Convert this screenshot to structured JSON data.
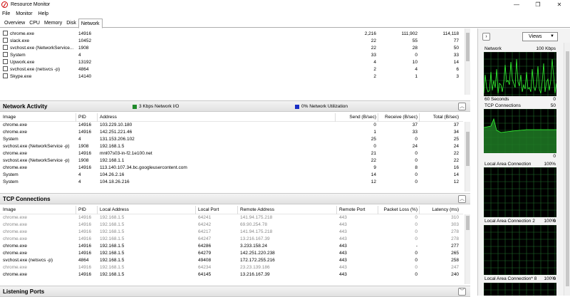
{
  "window": {
    "title": "Resource Monitor",
    "controls": {
      "minimize": "—",
      "restore": "❐",
      "close": "✕"
    }
  },
  "menu": [
    "File",
    "Monitor",
    "Help"
  ],
  "tabs": [
    {
      "label": "Overview",
      "active": false
    },
    {
      "label": "CPU",
      "active": false
    },
    {
      "label": "Memory",
      "active": false
    },
    {
      "label": "Disk",
      "active": false
    },
    {
      "label": "Network",
      "active": true
    }
  ],
  "processes": [
    {
      "name": "chrome.exe",
      "pid": "14916",
      "c1": "2,216",
      "c2": "111,902",
      "c3": "114,118"
    },
    {
      "name": "slack.exe",
      "pid": "10452",
      "c1": "22",
      "c2": "55",
      "c3": "77"
    },
    {
      "name": "svchost.exe (NetworkService...",
      "pid": "1908",
      "c1": "22",
      "c2": "28",
      "c3": "50"
    },
    {
      "name": "System",
      "pid": "4",
      "c1": "33",
      "c2": "0",
      "c3": "33"
    },
    {
      "name": "Upwork.exe",
      "pid": "13192",
      "c1": "4",
      "c2": "10",
      "c3": "14"
    },
    {
      "name": "svchost.exe (netsvcs -p)",
      "pid": "4864",
      "c1": "2",
      "c2": "4",
      "c3": "6"
    },
    {
      "name": "Skype.exe",
      "pid": "14140",
      "c1": "2",
      "c2": "1",
      "c3": "3"
    }
  ],
  "network_activity": {
    "title": "Network Activity",
    "legend_io": "3 Kbps Network I/O",
    "legend_util": "0% Network Utilization",
    "io_color": "#1f8a2a",
    "util_color": "#1a2fc4",
    "columns": [
      "Image",
      "PID",
      "Address",
      "Send (B/sec)",
      "Receive (B/sec)",
      "Total (B/sec)"
    ],
    "rows": [
      {
        "image": "chrome.exe",
        "pid": "14916",
        "address": "103.229.10.180",
        "send": "0",
        "recv": "37",
        "total": "37"
      },
      {
        "image": "chrome.exe",
        "pid": "14916",
        "address": "142.251.221.46",
        "send": "1",
        "recv": "33",
        "total": "34"
      },
      {
        "image": "System",
        "pid": "4",
        "address": "131.153.206.102",
        "send": "25",
        "recv": "0",
        "total": "25"
      },
      {
        "image": "svchost.exe (NetworkService -p)",
        "pid": "1908",
        "address": "192.168.1.5",
        "send": "0",
        "recv": "24",
        "total": "24"
      },
      {
        "image": "chrome.exe",
        "pid": "14916",
        "address": "mnl07s03-in-f2.1e100.net",
        "send": "21",
        "recv": "0",
        "total": "22"
      },
      {
        "image": "svchost.exe (NetworkService -p)",
        "pid": "1908",
        "address": "192.168.1.1",
        "send": "22",
        "recv": "0",
        "total": "22"
      },
      {
        "image": "chrome.exe",
        "pid": "14916",
        "address": "113.140.107.34.bc.googleusercontent.com",
        "send": "9",
        "recv": "8",
        "total": "16"
      },
      {
        "image": "System",
        "pid": "4",
        "address": "104.26.2.16",
        "send": "14",
        "recv": "0",
        "total": "14"
      },
      {
        "image": "System",
        "pid": "4",
        "address": "104.18.26.216",
        "send": "12",
        "recv": "0",
        "total": "12"
      }
    ]
  },
  "tcp": {
    "title": "TCP Connections",
    "columns": [
      "Image",
      "PID",
      "Local Address",
      "Local Port",
      "Remote Address",
      "Remote Port",
      "Packet Loss (%)",
      "Latency (ms)"
    ],
    "rows": [
      {
        "image": "chrome.exe",
        "pid": "14916",
        "laddr": "192.168.1.5",
        "lport": "64241",
        "raddr": "141.94.175.218",
        "rport": "443",
        "loss": "0",
        "lat": "310",
        "dim": true
      },
      {
        "image": "chrome.exe",
        "pid": "14916",
        "laddr": "192.168.1.5",
        "lport": "64242",
        "raddr": "69.90.254.78",
        "rport": "443",
        "loss": "0",
        "lat": "303",
        "dim": true
      },
      {
        "image": "chrome.exe",
        "pid": "14916",
        "laddr": "192.168.1.5",
        "lport": "64217",
        "raddr": "141.94.175.218",
        "rport": "443",
        "loss": "0",
        "lat": "278",
        "dim": true
      },
      {
        "image": "chrome.exe",
        "pid": "14916",
        "laddr": "192.168.1.5",
        "lport": "64247",
        "raddr": "13.216.167.39",
        "rport": "443",
        "loss": "0",
        "lat": "278",
        "dim": true
      },
      {
        "image": "chrome.exe",
        "pid": "14916",
        "laddr": "192.168.1.5",
        "lport": "64286",
        "raddr": "3.233.158.24",
        "rport": "443",
        "loss": "-",
        "lat": "277",
        "dim": false
      },
      {
        "image": "chrome.exe",
        "pid": "14916",
        "laddr": "192.168.1.5",
        "lport": "64279",
        "raddr": "142.251.220.238",
        "rport": "443",
        "loss": "0",
        "lat": "265",
        "dim": false
      },
      {
        "image": "svchost.exe (netsvcs -p)",
        "pid": "4864",
        "laddr": "192.168.1.5",
        "lport": "49408",
        "raddr": "172.172.255.216",
        "rport": "443",
        "loss": "0",
        "lat": "258",
        "dim": false
      },
      {
        "image": "chrome.exe",
        "pid": "14916",
        "laddr": "192.168.1.5",
        "lport": "64234",
        "raddr": "23.23.139.186",
        "rport": "443",
        "loss": "0",
        "lat": "247",
        "dim": true
      },
      {
        "image": "chrome.exe",
        "pid": "14916",
        "laddr": "192.168.1.5",
        "lport": "64145",
        "raddr": "13.216.167.39",
        "rport": "443",
        "loss": "0",
        "lat": "240",
        "dim": false
      }
    ]
  },
  "listening_ports": {
    "title": "Listening Ports"
  },
  "right_pane": {
    "views_label": "Views",
    "graphs": [
      {
        "name": "Network",
        "right": "100 Kbps",
        "bottom_left": "60 Seconds",
        "bottom_right": "0"
      },
      {
        "name": "TCP Connections",
        "right": "50",
        "bottom_left": "",
        "bottom_right": "0"
      },
      {
        "name": "Local Area Connection",
        "right": "100%",
        "bottom_left": "",
        "bottom_right": "0"
      },
      {
        "name": "Local Area Connection 2",
        "right": "100%",
        "bottom_left": "",
        "bottom_right": "0"
      },
      {
        "name": "Local Area Connection* 8",
        "right": "100%",
        "bottom_left": "",
        "bottom_right": ""
      }
    ],
    "grid_color": "#1f6b2a",
    "line_color": "#33ff33"
  }
}
